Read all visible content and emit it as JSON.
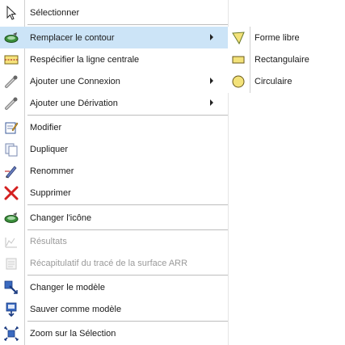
{
  "menu": {
    "items": [
      {
        "label": "Sélectionner",
        "icon": "cursor-icon",
        "enabled": true
      },
      {
        "label": "Remplacer le contour",
        "icon": "contour-icon",
        "enabled": true,
        "highlighted": true,
        "submenu": true
      },
      {
        "label": "Respécifier la ligne centrale",
        "icon": "centerline-icon",
        "enabled": true
      },
      {
        "label": "Ajouter une Connexion",
        "icon": "pipe-connection-icon",
        "enabled": true,
        "submenu": true
      },
      {
        "label": "Ajouter une Dérivation",
        "icon": "pipe-branch-icon",
        "enabled": true,
        "submenu": true
      },
      {
        "label": "Modifier",
        "icon": "edit-icon",
        "enabled": true
      },
      {
        "label": "Dupliquer",
        "icon": "duplicate-icon",
        "enabled": true
      },
      {
        "label": "Renommer",
        "icon": "rename-icon",
        "enabled": true
      },
      {
        "label": "Supprimer",
        "icon": "delete-icon",
        "enabled": true
      },
      {
        "label": "Changer l'icône",
        "icon": "change-icon-icon",
        "enabled": true
      },
      {
        "label": "Résultats",
        "icon": "results-icon",
        "enabled": false
      },
      {
        "label": "Récapitulatif du tracé de la surface ARR",
        "icon": "summary-icon",
        "enabled": false
      },
      {
        "label": "Changer le modèle",
        "icon": "change-model-icon",
        "enabled": true
      },
      {
        "label": "Sauver comme modèle",
        "icon": "save-model-icon",
        "enabled": true
      },
      {
        "label": "Zoom sur la Sélection",
        "icon": "zoom-selection-icon",
        "enabled": true
      }
    ]
  },
  "submenu": {
    "items": [
      {
        "label": "Forme libre",
        "icon": "freeform-icon"
      },
      {
        "label": "Rectangulaire",
        "icon": "rectangle-icon"
      },
      {
        "label": "Circulaire",
        "icon": "circle-icon"
      }
    ]
  },
  "colors": {
    "highlight": "#cce4f7",
    "disabled_text": "#9a9a9a",
    "separator": "#bdbdbd",
    "accent_green": "#3a8f3a",
    "delete_red": "#d42020",
    "shape_yellow": "#f3e27a"
  }
}
